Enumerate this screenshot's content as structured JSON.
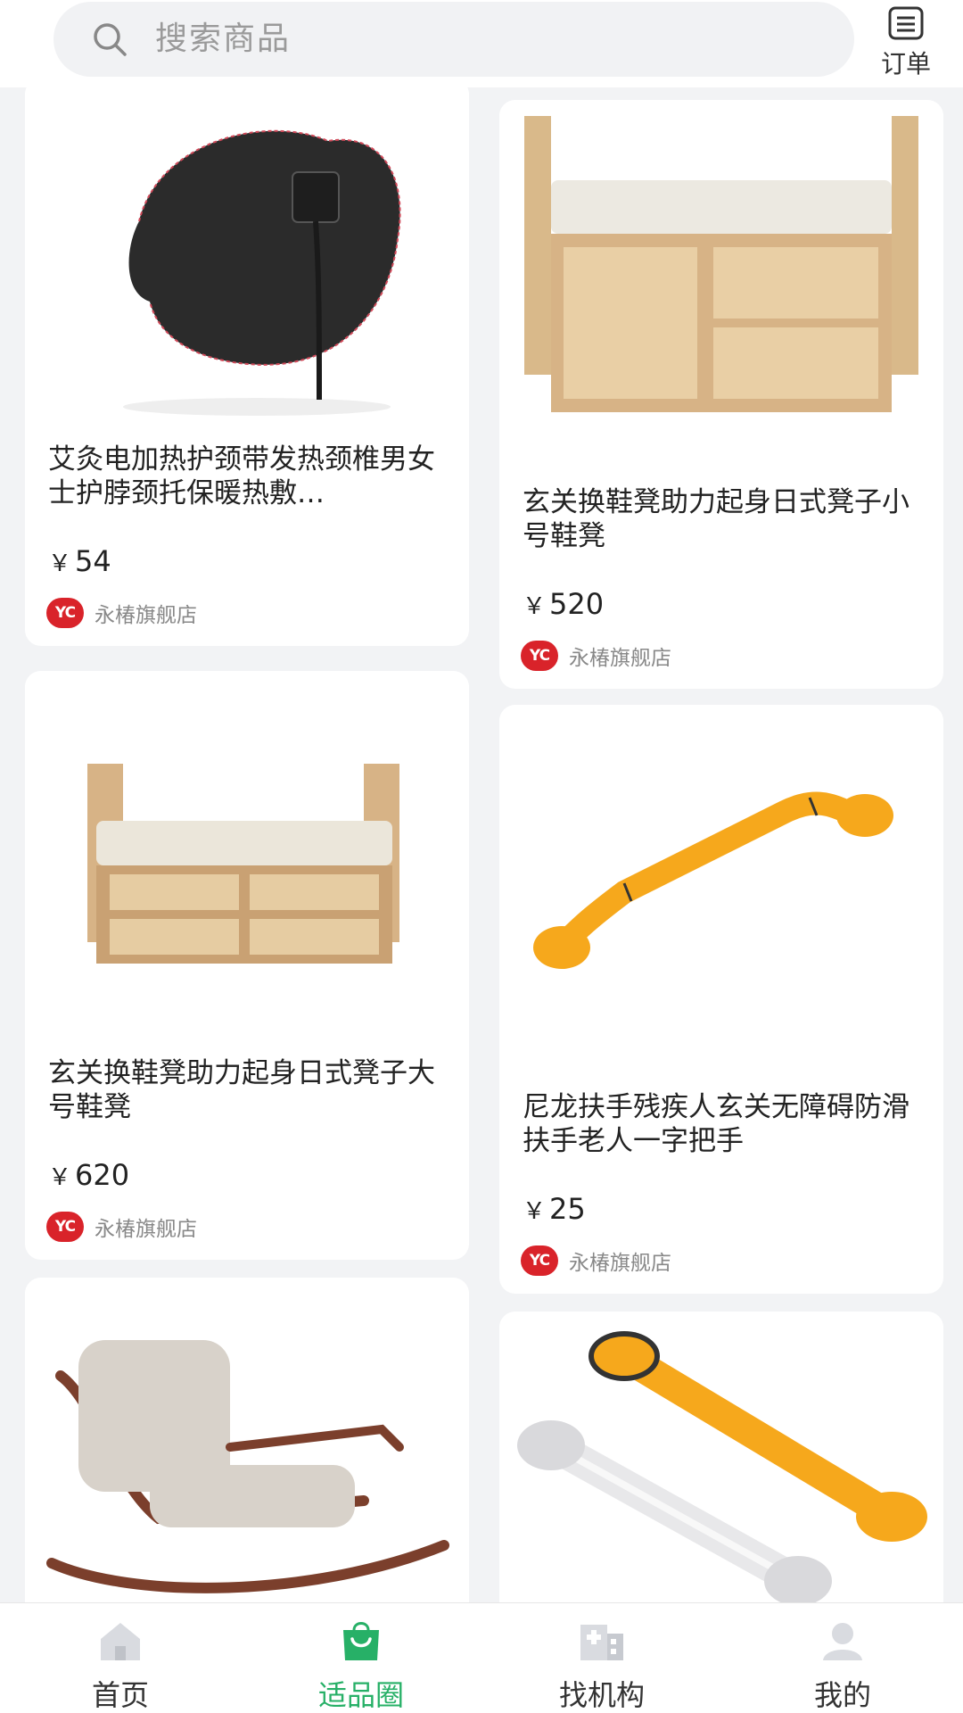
{
  "search": {
    "placeholder": "搜索商品"
  },
  "header": {
    "orders_label": "订单"
  },
  "products": [
    {
      "title": "艾灸电加热护颈带发热颈椎男女士护脖颈托保暖热敷…",
      "currency": "￥",
      "price": "54",
      "shop": "永椿旗舰店",
      "shop_logo": "YC"
    },
    {
      "title": "玄关换鞋凳助力起身日式凳子小号鞋凳",
      "currency": "￥",
      "price": "520",
      "shop": "永椿旗舰店",
      "shop_logo": "YC"
    },
    {
      "title": "玄关换鞋凳助力起身日式凳子大号鞋凳",
      "currency": "￥",
      "price": "620",
      "shop": "永椿旗舰店",
      "shop_logo": "YC"
    },
    {
      "title": "尼龙扶手残疾人玄关无障碍防滑扶手老人一字把手",
      "currency": "￥",
      "price": "25",
      "shop": "永椿旗舰店",
      "shop_logo": "YC"
    },
    {
      "title": "",
      "currency": "",
      "price": "",
      "shop": "",
      "shop_logo": ""
    },
    {
      "title": "",
      "currency": "",
      "price": "",
      "shop": "",
      "shop_logo": ""
    }
  ],
  "nav": [
    {
      "label": "首页",
      "icon": "home-icon",
      "active": false
    },
    {
      "label": "适品圈",
      "icon": "shopping-bag-icon",
      "active": true
    },
    {
      "label": "找机构",
      "icon": "hospital-icon",
      "active": false
    },
    {
      "label": "我的",
      "icon": "user-icon",
      "active": false
    }
  ],
  "colors": {
    "accent": "#27b067",
    "shop_logo": "#d9232a",
    "background": "#f2f3f5"
  }
}
